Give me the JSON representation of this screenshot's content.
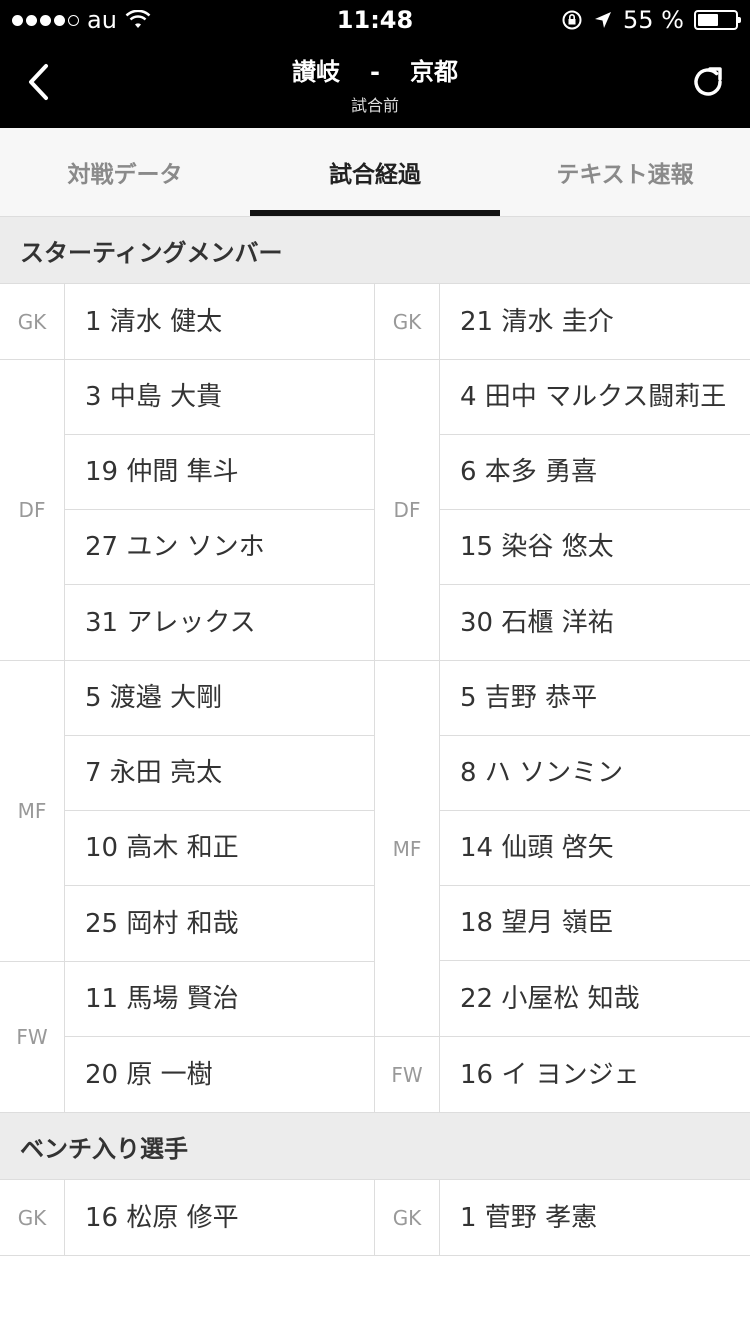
{
  "status_bar": {
    "carrier": "au",
    "time": "11:48",
    "battery": "55 %",
    "battery_level": 0.55
  },
  "header": {
    "home_team": "讃岐",
    "separator": "-",
    "away_team": "京都",
    "status": "試合前"
  },
  "tabs": [
    {
      "label": "対戦データ",
      "active": false
    },
    {
      "label": "試合経過",
      "active": true
    },
    {
      "label": "テキスト速報",
      "active": false
    }
  ],
  "starting": {
    "title": "スターティングメンバー",
    "home": [
      {
        "pos": "GK",
        "players": [
          "1 清水 健太"
        ]
      },
      {
        "pos": "DF",
        "players": [
          "3 中島 大貴",
          "19 仲間 隼斗",
          "27 ユン ソンホ",
          "31 アレックス"
        ]
      },
      {
        "pos": "MF",
        "players": [
          "5 渡邉 大剛",
          "7 永田 亮太",
          "10 高木 和正",
          "25 岡村 和哉"
        ]
      },
      {
        "pos": "FW",
        "players": [
          "11 馬場 賢治",
          "20 原 一樹"
        ]
      }
    ],
    "away": [
      {
        "pos": "GK",
        "players": [
          "21 清水 圭介"
        ]
      },
      {
        "pos": "DF",
        "players": [
          "4 田中 マルクス闘莉王",
          "6 本多 勇喜",
          "15 染谷 悠太",
          "30 石櫃 洋祐"
        ]
      },
      {
        "pos": "MF",
        "players": [
          "5 吉野 恭平",
          "8 ハ ソンミン",
          "14 仙頭 啓矢",
          "18 望月 嶺臣",
          "22 小屋松 知哉"
        ]
      },
      {
        "pos": "FW",
        "players": [
          "16 イ ヨンジェ"
        ]
      }
    ]
  },
  "bench": {
    "title": "ベンチ入り選手",
    "home": [
      {
        "pos": "GK",
        "players": [
          "16 松原 修平"
        ]
      }
    ],
    "away": [
      {
        "pos": "GK",
        "players": [
          "1 菅野 孝憲"
        ]
      }
    ]
  }
}
